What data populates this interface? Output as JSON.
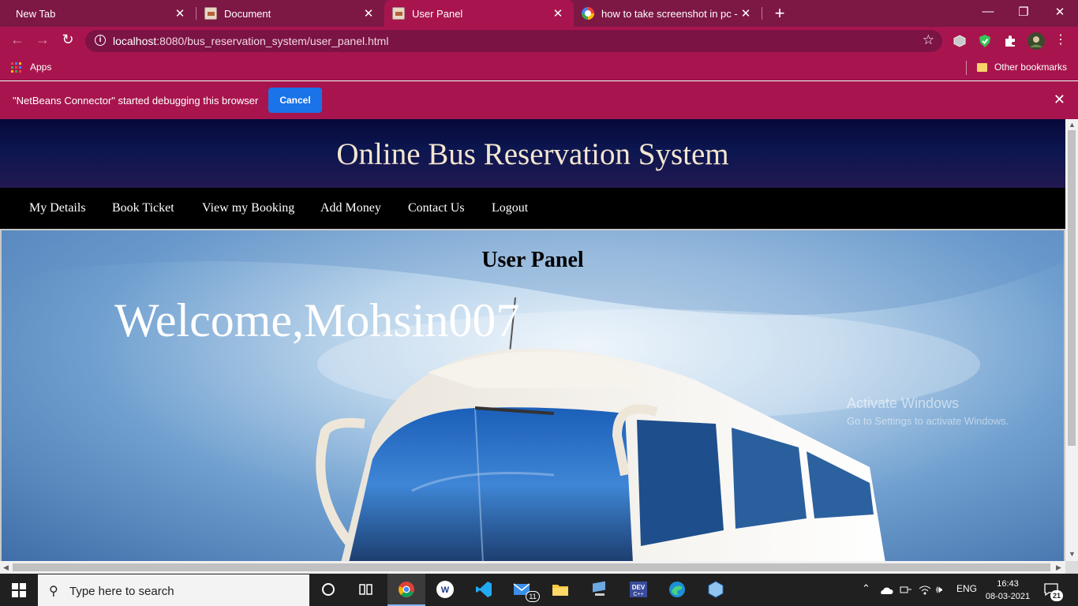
{
  "browser": {
    "tabs": [
      {
        "title": "New Tab",
        "close": "✕"
      },
      {
        "title": "Document",
        "close": "✕"
      },
      {
        "title": "User Panel",
        "close": "✕"
      },
      {
        "title": "how to take screenshot in pc - G",
        "close": "✕"
      }
    ],
    "new_tab": "+",
    "window": {
      "minimize": "—",
      "restore": "❐",
      "close": "✕"
    },
    "nav": {
      "back": "←",
      "forward": "→",
      "reload": "↻"
    },
    "url": {
      "host": "localhost",
      "rest": ":8080/bus_reservation_system/user_panel.html"
    },
    "bookmarks": {
      "apps": "Apps",
      "other": "Other bookmarks"
    },
    "infobar": {
      "message": "\"NetBeans Connector\" started debugging this browser",
      "cancel": "Cancel",
      "close": "✕"
    }
  },
  "site": {
    "title": "Online Bus Reservation System",
    "nav": [
      "My Details",
      "Book Ticket",
      "View my Booking",
      "Add Money",
      "Contact Us",
      "Logout"
    ],
    "panel_title": "User Panel",
    "welcome": "Welcome,Mohsin007"
  },
  "watermark": {
    "line1": "Activate Windows",
    "line2": "Go to Settings to activate Windows."
  },
  "taskbar": {
    "search_placeholder": "Type here to search",
    "mail_badge": "11",
    "language": "ENG",
    "time": "16:43",
    "date": "08-03-2021",
    "notifications": "21"
  },
  "colors": {
    "tab_bg": "#7d1744",
    "toolbar_bg": "#a8154e",
    "cancel_btn": "#1a73e8",
    "header_text": "#f4e6cf"
  }
}
